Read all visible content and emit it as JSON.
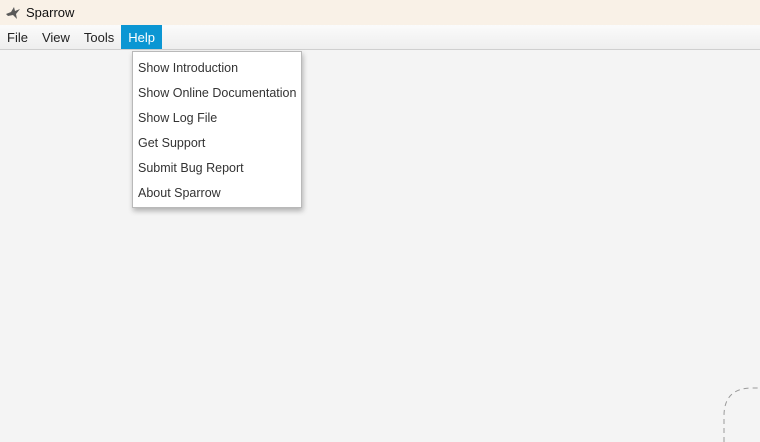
{
  "window": {
    "title": "Sparrow",
    "icon": "bird-icon"
  },
  "menubar": {
    "items": [
      {
        "label": "File"
      },
      {
        "label": "View"
      },
      {
        "label": "Tools"
      },
      {
        "label": "Help",
        "active": true
      }
    ]
  },
  "help_menu": {
    "items": [
      {
        "label": "Show Introduction"
      },
      {
        "label": "Show Online Documentation"
      },
      {
        "label": "Show Log File"
      },
      {
        "label": "Get Support"
      },
      {
        "label": "Submit Bug Report"
      },
      {
        "label": "About Sparrow"
      }
    ]
  },
  "colors": {
    "accent": "#0b96d3",
    "titlebar": "#f9f1e7",
    "background": "#f4f4f4"
  }
}
